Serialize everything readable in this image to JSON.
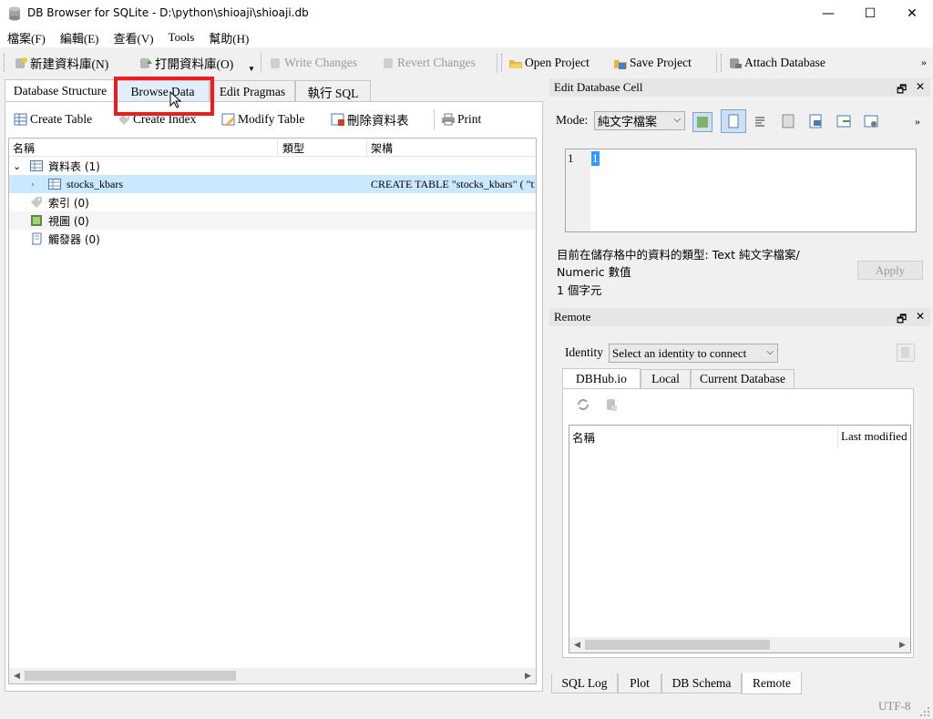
{
  "window": {
    "title": "DB Browser for SQLite - D:\\python\\shioaji\\shioaji.db",
    "minimize": "—",
    "maximize": "☐",
    "close": "✕"
  },
  "menu": [
    "檔案(F)",
    "編輯(E)",
    "查看(V)",
    "Tools",
    "幫助(H)"
  ],
  "toolbar": {
    "new_db": "新建資料庫(N)",
    "open_db": "打開資料庫(O)",
    "write_changes": "Write Changes",
    "revert_changes": "Revert Changes",
    "open_project": "Open Project",
    "save_project": "Save Project",
    "attach_db": "Attach Database",
    "overflow": "»"
  },
  "tabs": [
    "Database Structure",
    "Browse Data",
    "Edit Pragmas",
    "執行 SQL"
  ],
  "actions": {
    "create_table": "Create Table",
    "create_index": "Create Index",
    "modify_table": "Modify Table",
    "delete": "刪除資料表",
    "print": "Print"
  },
  "tree": {
    "headers": [
      "名稱",
      "類型",
      "架構"
    ],
    "rows": [
      {
        "name": "資料表 (1)",
        "type": "",
        "schema": ""
      },
      {
        "name": "stocks_kbars",
        "type": "",
        "schema": "CREATE TABLE \"stocks_kbars\" ( \"ti"
      },
      {
        "name": "索引 (0)",
        "type": "",
        "schema": ""
      },
      {
        "name": "視圖 (0)",
        "type": "",
        "schema": ""
      },
      {
        "name": "觸發器 (0)",
        "type": "",
        "schema": ""
      }
    ]
  },
  "edit_cell": {
    "title": "Edit Database Cell",
    "mode_label": "Mode:",
    "mode_value": "純文字檔案",
    "line_number": "1",
    "cell_value": "1",
    "type_info_1": "目前在儲存格中的資料的類型: Text 純文字檔案/",
    "type_info_2": "Numeric 數值",
    "char_count": "1 個字元",
    "apply": "Apply",
    "overflow": "»"
  },
  "remote": {
    "title": "Remote",
    "identity_label": "Identity",
    "identity_value": "Select an identity to connect",
    "tabs": [
      "DBHub.io",
      "Local",
      "Current Database"
    ],
    "columns": [
      "名稱",
      "Last modified"
    ]
  },
  "dock_ctrl": {
    "float": "🗗",
    "close": "✕"
  },
  "bottom_tabs": [
    "SQL Log",
    "Plot",
    "DB Schema",
    "Remote"
  ],
  "status": {
    "encoding": "UTF-8"
  },
  "colors": {
    "highlight": "#ee1c1c",
    "selection": "#cce8ff"
  }
}
